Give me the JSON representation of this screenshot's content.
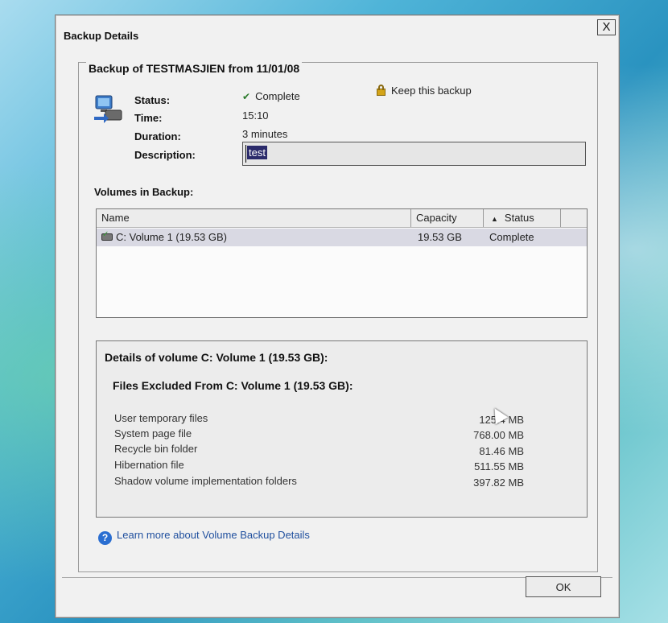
{
  "window": {
    "title": "Backup Details",
    "close_label": "X"
  },
  "backup": {
    "group_title": "Backup of TESTMASJIEN from 11/01/08",
    "status_label": "Status:",
    "status_value": "Complete",
    "time_label": "Time:",
    "time_value": "15:10",
    "duration_label": "Duration:",
    "duration_value": "3 minutes",
    "description_label": "Description:",
    "description_value": "test",
    "keep_label": "Keep this backup"
  },
  "volumes": {
    "section_title": "Volumes in Backup:",
    "columns": {
      "name": "Name",
      "capacity": "Capacity",
      "status": "Status",
      "status_sort_icon": "▲"
    },
    "rows": [
      {
        "name": "C: Volume 1 (19.53 GB)",
        "capacity": "19.53 GB",
        "status": "Complete"
      }
    ]
  },
  "details": {
    "heading": "Details of volume C: Volume 1 (19.53 GB):",
    "excluded_heading": "Files Excluded From C: Volume 1 (19.53 GB):",
    "files": [
      {
        "name": "User temporary files",
        "size": "125.4 MB"
      },
      {
        "name": "System page file",
        "size": "768.00 MB"
      },
      {
        "name": "Recycle bin folder",
        "size": "81.46 MB"
      },
      {
        "name": "Hibernation file",
        "size": "511.55 MB"
      },
      {
        "name": "Shadow volume implementation folders",
        "size": "397.82 MB"
      }
    ]
  },
  "help": {
    "link_text": "Learn more about Volume Backup Details",
    "icon": "?"
  },
  "buttons": {
    "ok": "OK"
  },
  "colors": {
    "selection": "#2b2b6b",
    "link": "#1f4f9e",
    "help_icon": "#2a6ed1",
    "lock": "#d4a418"
  }
}
